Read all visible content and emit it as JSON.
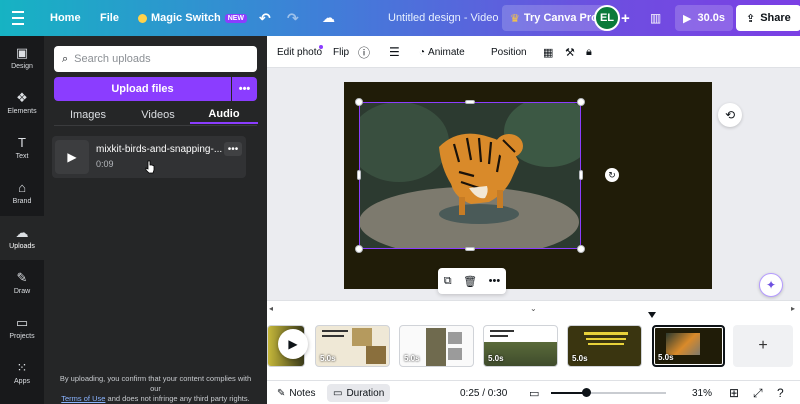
{
  "topbar": {
    "home": "Home",
    "file": "File",
    "magic_switch": "Magic Switch",
    "new_badge": "NEW",
    "title": "Untitled design - Video",
    "try_pro": "Try Canva Pro",
    "avatar_initials": "EL",
    "play_duration": "30.0s",
    "share": "Share"
  },
  "rail": {
    "items": [
      {
        "label": "Design",
        "icon": "layout-icon"
      },
      {
        "label": "Elements",
        "icon": "shapes-icon"
      },
      {
        "label": "Text",
        "icon": "text-icon"
      },
      {
        "label": "Brand",
        "icon": "brand-icon"
      },
      {
        "label": "Uploads",
        "icon": "cloud-upload-icon"
      },
      {
        "label": "Draw",
        "icon": "pen-icon"
      },
      {
        "label": "Projects",
        "icon": "folder-icon"
      },
      {
        "label": "Apps",
        "icon": "grid-icon"
      }
    ],
    "active": "Uploads"
  },
  "panel": {
    "search_placeholder": "Search uploads",
    "upload_button": "Upload files",
    "tabs": [
      "Images",
      "Videos",
      "Audio"
    ],
    "active_tab": "Audio",
    "audio_items": [
      {
        "name": "mixkit-birds-and-snapping-...",
        "duration": "0:09"
      }
    ],
    "footer_text_1": "By uploading, you confirm that your content complies with our",
    "footer_link_terms": "Terms of Use",
    "footer_text_2": "and does not infringe any third party rights."
  },
  "context_toolbar": {
    "edit_photo": "Edit photo",
    "flip": "Flip",
    "animate": "Animate",
    "position": "Position"
  },
  "timeline": {
    "clips": [
      {
        "duration": "",
        "theme": "yellow-partial"
      },
      {
        "duration": "5.0s",
        "theme": "beige-collage"
      },
      {
        "duration": "5.0s",
        "theme": "white-collage"
      },
      {
        "duration": "5.0s",
        "theme": "white-forest"
      },
      {
        "duration": "5.0s",
        "theme": "dark-yellow"
      },
      {
        "duration": "5.0s",
        "theme": "tiger-selected"
      }
    ],
    "add_page": "+"
  },
  "footer": {
    "notes": "Notes",
    "duration": "Duration",
    "time": "0:25 / 0:30",
    "zoom": "31%",
    "playback_progress": 0.3
  },
  "colors": {
    "accent": "#8b3dff",
    "rail_bg": "#18191b",
    "panel_bg": "#252627",
    "page_bg": "#201c08"
  }
}
